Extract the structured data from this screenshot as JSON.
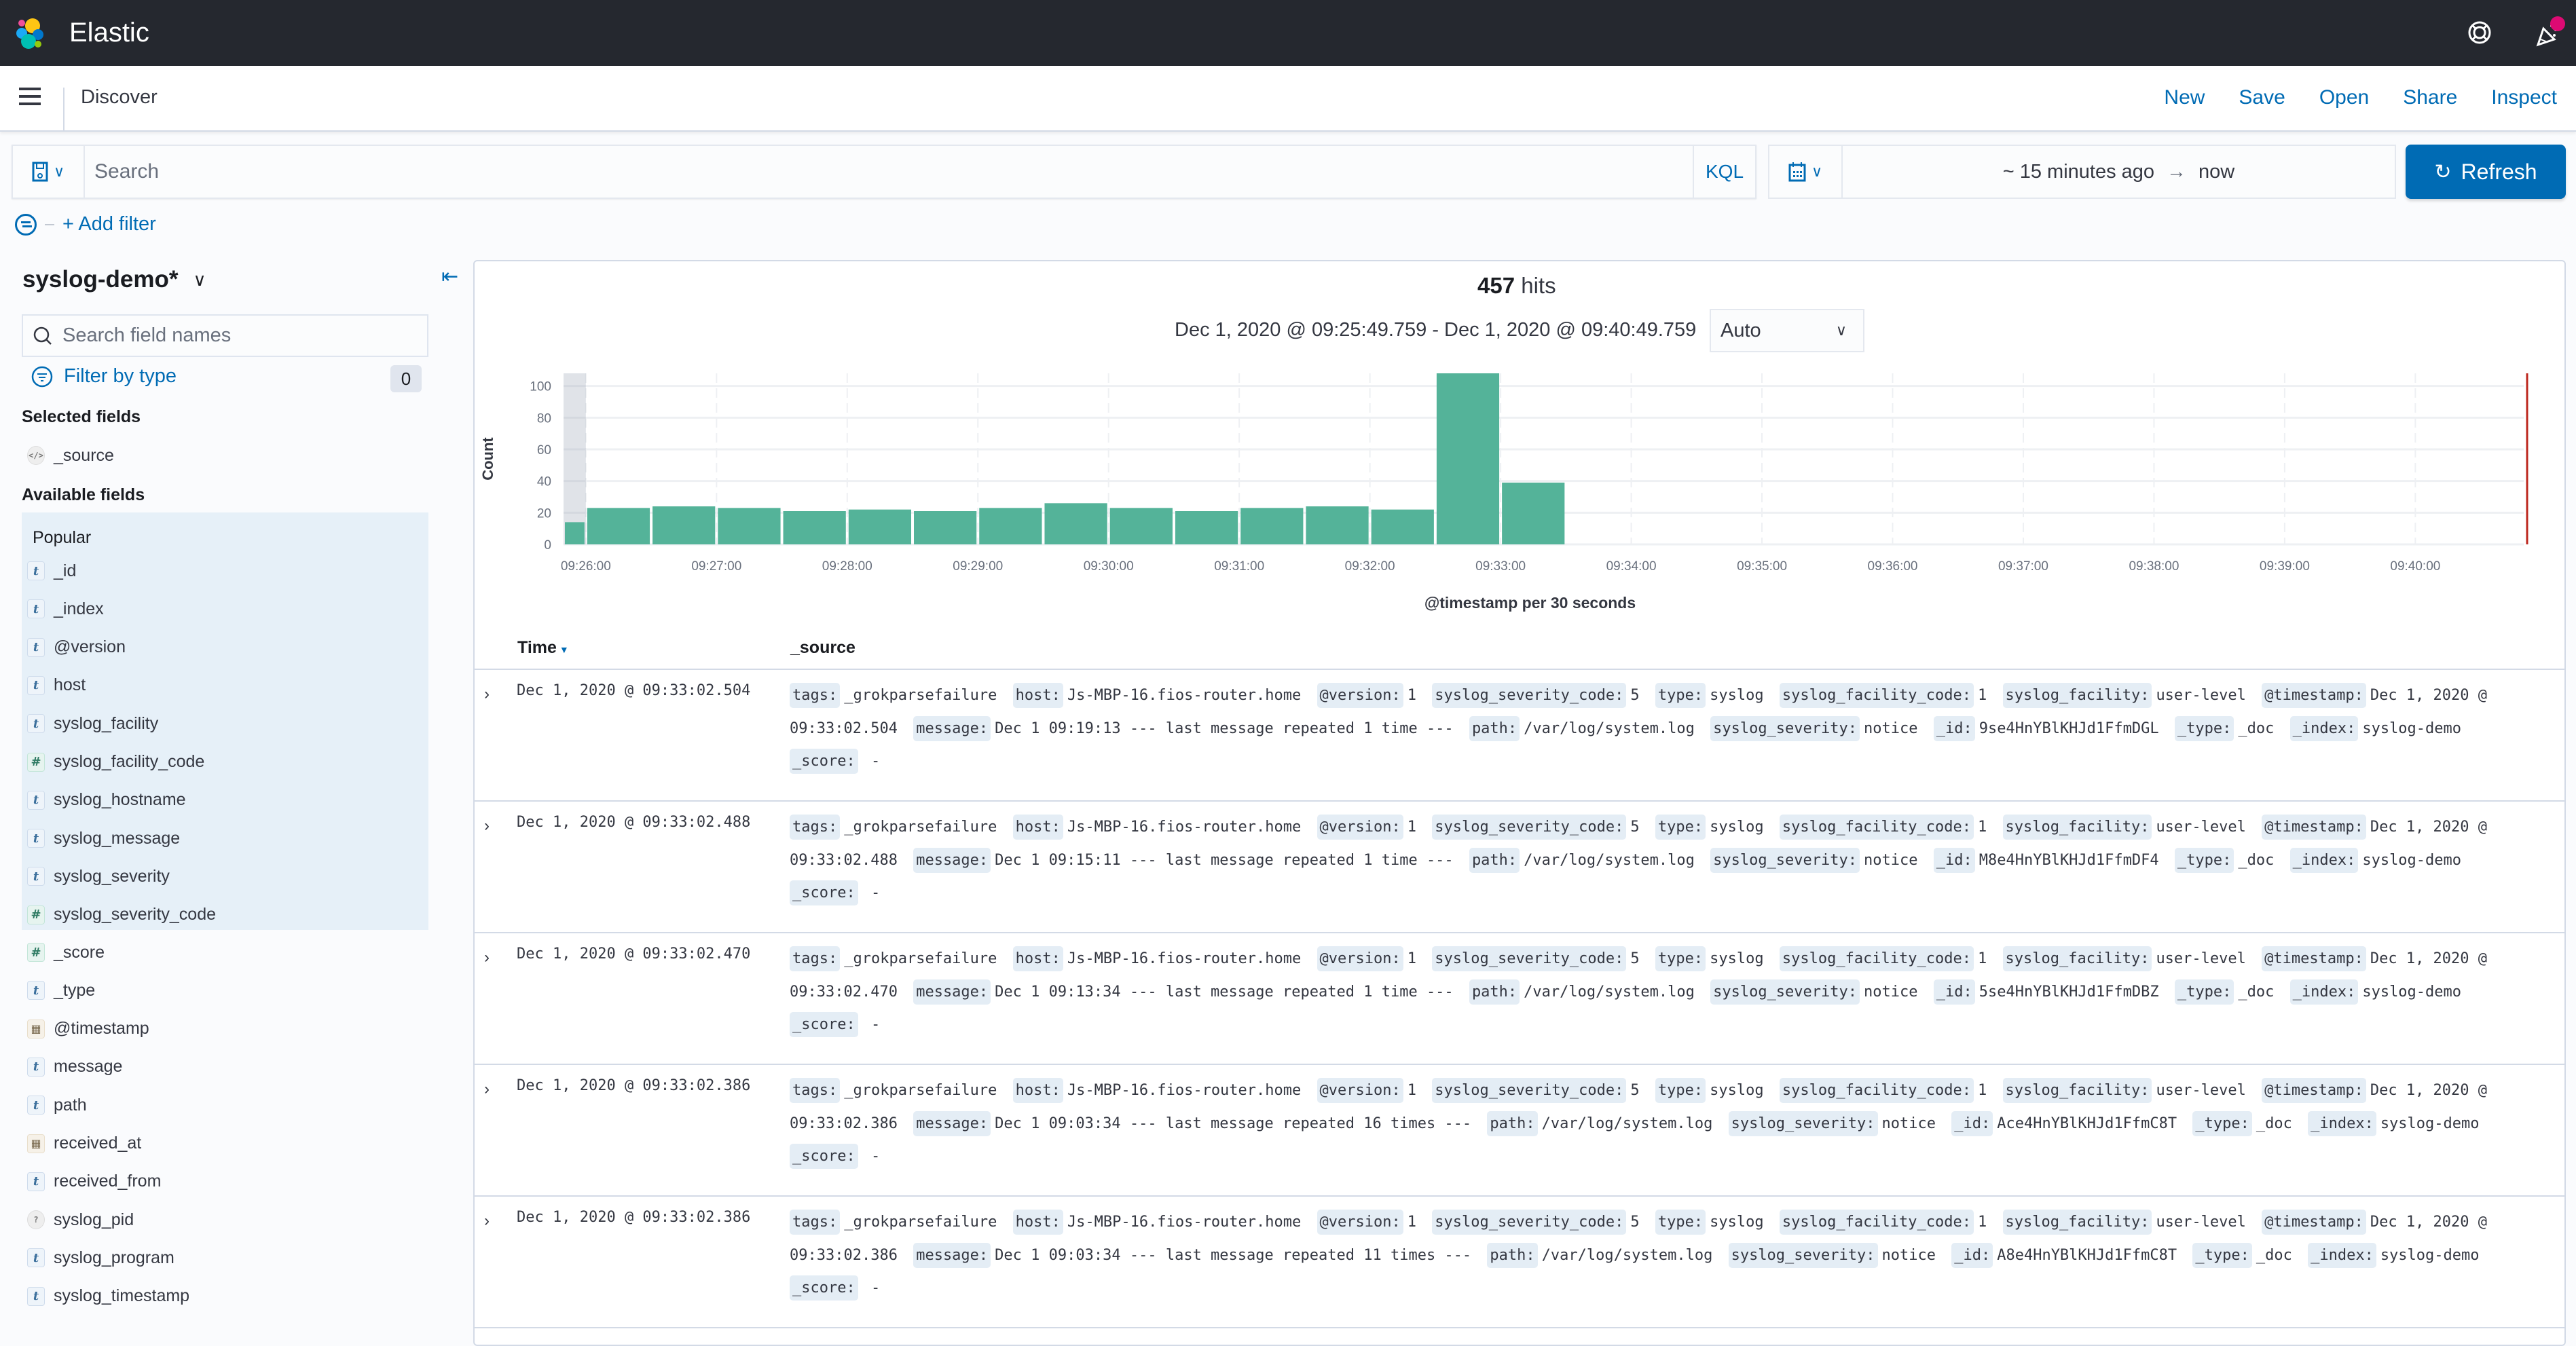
{
  "header": {
    "brand": "Elastic",
    "icons": [
      "help-icon",
      "newsfeed-icon"
    ],
    "newsfeed_badge_color": "#dd0a73"
  },
  "appbar": {
    "title": "Discover",
    "links": [
      "New",
      "Save",
      "Open",
      "Share",
      "Inspect"
    ]
  },
  "query": {
    "placeholder": "Search",
    "value": "",
    "language": "KQL"
  },
  "time": {
    "start": "~ 15 minutes ago",
    "end": "now",
    "refresh_label": "Refresh"
  },
  "filters": {
    "add_label": "+ Add filter"
  },
  "sidebar": {
    "index_pattern": "syslog-demo*",
    "field_search_placeholder": "Search field names",
    "filter_by_type_label": "Filter by type",
    "filter_count": "0",
    "selected_title": "Selected fields",
    "selected_fields": [
      {
        "name": "_source",
        "type": "source"
      }
    ],
    "available_title": "Available fields",
    "popular_label": "Popular",
    "popular_fields": [
      {
        "name": "_id",
        "type": "string"
      },
      {
        "name": "_index",
        "type": "string"
      },
      {
        "name": "@version",
        "type": "string"
      },
      {
        "name": "host",
        "type": "string"
      },
      {
        "name": "syslog_facility",
        "type": "string"
      },
      {
        "name": "syslog_facility_code",
        "type": "number"
      },
      {
        "name": "syslog_hostname",
        "type": "string"
      },
      {
        "name": "syslog_message",
        "type": "string"
      },
      {
        "name": "syslog_severity",
        "type": "string"
      },
      {
        "name": "syslog_severity_code",
        "type": "number"
      }
    ],
    "other_fields": [
      {
        "name": "_score",
        "type": "number"
      },
      {
        "name": "_type",
        "type": "string"
      },
      {
        "name": "@timestamp",
        "type": "date"
      },
      {
        "name": "message",
        "type": "string"
      },
      {
        "name": "path",
        "type": "string"
      },
      {
        "name": "received_at",
        "type": "date"
      },
      {
        "name": "received_from",
        "type": "string"
      },
      {
        "name": "syslog_pid",
        "type": "unknown"
      },
      {
        "name": "syslog_program",
        "type": "string"
      },
      {
        "name": "syslog_timestamp",
        "type": "string"
      }
    ]
  },
  "histogram": {
    "hits_count": "457",
    "hits_label": "hits",
    "range_label": "Dec 1, 2020 @ 09:25:49.759 - Dec 1, 2020 @ 09:40:49.759",
    "interval": "Auto"
  },
  "chart_data": {
    "type": "bar",
    "title": "",
    "xlabel": "@timestamp per 30 seconds",
    "ylabel": "Count",
    "ylim": [
      0,
      108
    ],
    "yticks": [
      0,
      20,
      40,
      60,
      80,
      100
    ],
    "x_range": [
      "09:25:49.759",
      "09:40:49.759"
    ],
    "xticks": [
      "09:26:00",
      "09:27:00",
      "09:28:00",
      "09:29:00",
      "09:30:00",
      "09:31:00",
      "09:32:00",
      "09:33:00",
      "09:34:00",
      "09:35:00",
      "09:36:00",
      "09:37:00",
      "09:38:00",
      "09:39:00",
      "09:40:00"
    ],
    "bucket_seconds": 30,
    "categories": [
      "09:25:30",
      "09:26:00",
      "09:26:30",
      "09:27:00",
      "09:27:30",
      "09:28:00",
      "09:28:30",
      "09:29:00",
      "09:29:30",
      "09:30:00",
      "09:30:30",
      "09:31:00",
      "09:31:30",
      "09:32:00",
      "09:32:30",
      "09:33:00"
    ],
    "values": [
      14,
      23,
      24,
      23,
      21,
      22,
      21,
      23,
      26,
      23,
      21,
      23,
      24,
      22,
      108,
      39
    ],
    "bar_color": "#54b399",
    "now_marker_color": "#bd271e",
    "grid": true
  },
  "table": {
    "columns": [
      "Time",
      "_source"
    ],
    "sort": "desc",
    "rows": [
      {
        "time": "Dec 1, 2020 @ 09:33:02.504",
        "source": [
          [
            "tags:",
            "_grokparsefailure"
          ],
          [
            "host:",
            "Js-MBP-16.fios-router.home"
          ],
          [
            "@version:",
            "1"
          ],
          [
            "syslog_severity_code:",
            "5"
          ],
          [
            "type:",
            "syslog"
          ],
          [
            "syslog_facility_code:",
            "1"
          ],
          [
            "syslog_facility:",
            "user-level"
          ],
          [
            "@timestamp:",
            "Dec 1, 2020 @ 09:33:02.504"
          ],
          [
            "message:",
            "Dec 1 09:19:13 --- last message repeated 1 time ---"
          ],
          [
            "path:",
            "/var/log/system.log"
          ],
          [
            "syslog_severity:",
            "notice"
          ],
          [
            "_id:",
            "9se4HnYBlKHJd1FfmDGL"
          ],
          [
            "_type:",
            "_doc"
          ],
          [
            "_index:",
            "syslog-demo"
          ],
          [
            "_score:",
            " -"
          ]
        ]
      },
      {
        "time": "Dec 1, 2020 @ 09:33:02.488",
        "source": [
          [
            "tags:",
            "_grokparsefailure"
          ],
          [
            "host:",
            "Js-MBP-16.fios-router.home"
          ],
          [
            "@version:",
            "1"
          ],
          [
            "syslog_severity_code:",
            "5"
          ],
          [
            "type:",
            "syslog"
          ],
          [
            "syslog_facility_code:",
            "1"
          ],
          [
            "syslog_facility:",
            "user-level"
          ],
          [
            "@timestamp:",
            "Dec 1, 2020 @ 09:33:02.488"
          ],
          [
            "message:",
            "Dec 1 09:15:11 --- last message repeated 1 time ---"
          ],
          [
            "path:",
            "/var/log/system.log"
          ],
          [
            "syslog_severity:",
            "notice"
          ],
          [
            "_id:",
            "M8e4HnYBlKHJd1FfmDF4"
          ],
          [
            "_type:",
            "_doc"
          ],
          [
            "_index:",
            "syslog-demo"
          ],
          [
            "_score:",
            " -"
          ]
        ]
      },
      {
        "time": "Dec 1, 2020 @ 09:33:02.470",
        "source": [
          [
            "tags:",
            "_grokparsefailure"
          ],
          [
            "host:",
            "Js-MBP-16.fios-router.home"
          ],
          [
            "@version:",
            "1"
          ],
          [
            "syslog_severity_code:",
            "5"
          ],
          [
            "type:",
            "syslog"
          ],
          [
            "syslog_facility_code:",
            "1"
          ],
          [
            "syslog_facility:",
            "user-level"
          ],
          [
            "@timestamp:",
            "Dec 1, 2020 @ 09:33:02.470"
          ],
          [
            "message:",
            "Dec 1 09:13:34 --- last message repeated 1 time ---"
          ],
          [
            "path:",
            "/var/log/system.log"
          ],
          [
            "syslog_severity:",
            "notice"
          ],
          [
            "_id:",
            "5se4HnYBlKHJd1FfmDBZ"
          ],
          [
            "_type:",
            "_doc"
          ],
          [
            "_index:",
            "syslog-demo"
          ],
          [
            "_score:",
            " -"
          ]
        ]
      },
      {
        "time": "Dec 1, 2020 @ 09:33:02.386",
        "source": [
          [
            "tags:",
            "_grokparsefailure"
          ],
          [
            "host:",
            "Js-MBP-16.fios-router.home"
          ],
          [
            "@version:",
            "1"
          ],
          [
            "syslog_severity_code:",
            "5"
          ],
          [
            "type:",
            "syslog"
          ],
          [
            "syslog_facility_code:",
            "1"
          ],
          [
            "syslog_facility:",
            "user-level"
          ],
          [
            "@timestamp:",
            "Dec 1, 2020 @ 09:33:02.386"
          ],
          [
            "message:",
            "Dec 1 09:03:34 --- last message repeated 16 times ---"
          ],
          [
            "path:",
            "/var/log/system.log"
          ],
          [
            "syslog_severity:",
            "notice"
          ],
          [
            "_id:",
            "Ace4HnYBlKHJd1FfmC8T"
          ],
          [
            "_type:",
            "_doc"
          ],
          [
            "_index:",
            "syslog-demo"
          ],
          [
            "_score:",
            " -"
          ]
        ]
      },
      {
        "time": "Dec 1, 2020 @ 09:33:02.386",
        "source": [
          [
            "tags:",
            "_grokparsefailure"
          ],
          [
            "host:",
            "Js-MBP-16.fios-router.home"
          ],
          [
            "@version:",
            "1"
          ],
          [
            "syslog_severity_code:",
            "5"
          ],
          [
            "type:",
            "syslog"
          ],
          [
            "syslog_facility_code:",
            "1"
          ],
          [
            "syslog_facility:",
            "user-level"
          ],
          [
            "@timestamp:",
            "Dec 1, 2020 @ 09:33:02.386"
          ],
          [
            "message:",
            "Dec 1 09:03:34 --- last message repeated 11 times ---"
          ],
          [
            "path:",
            "/var/log/system.log"
          ],
          [
            "syslog_severity:",
            "notice"
          ],
          [
            "_id:",
            "A8e4HnYBlKHJd1FfmC8T"
          ],
          [
            "_type:",
            "_doc"
          ],
          [
            "_index:",
            "syslog-demo"
          ],
          [
            "_score:",
            " -"
          ]
        ]
      }
    ]
  }
}
